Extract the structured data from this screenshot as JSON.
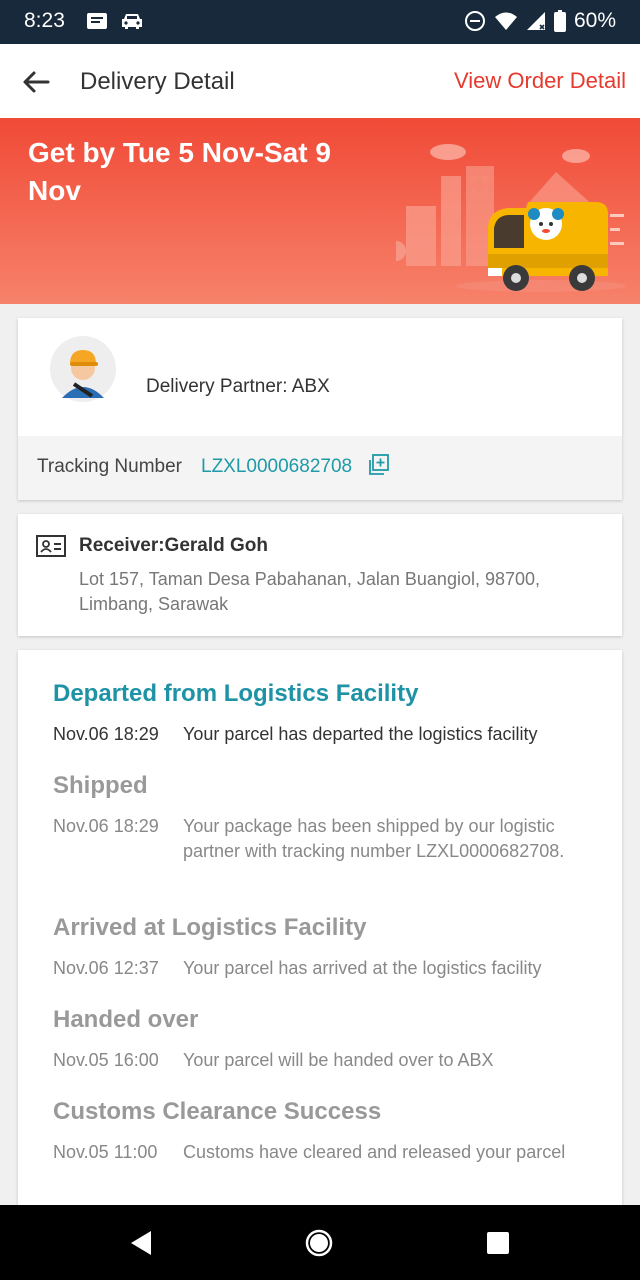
{
  "status_bar": {
    "time": "8:23",
    "battery": "60%",
    "icons_left": [
      "message-icon",
      "car-icon"
    ],
    "icons_right": [
      "do-not-disturb-icon",
      "wifi-icon",
      "signal-icon",
      "battery-icon"
    ]
  },
  "header": {
    "title": "Delivery Detail",
    "order_link": "View Order Detail",
    "accent_color": "#e53a2e"
  },
  "banner": {
    "eta": "Get by Tue 5 Nov-Sat 9 Nov"
  },
  "partner": {
    "label": "Delivery Partner: ABX",
    "tracking_label": "Tracking Number",
    "tracking_number": "LZXL0000682708"
  },
  "receiver": {
    "name": "Receiver:Gerald Goh",
    "address": "Lot 157, Taman Desa Pabahanan, Jalan Buangiol, 98700, Limbang, Sarawak"
  },
  "timeline": {
    "events": [
      {
        "title": "Departed from Logistics Facility",
        "time": "Nov.06 18:29",
        "desc": "Your parcel has departed the logistics facility"
      },
      {
        "title": "Shipped",
        "time": "Nov.06 18:29",
        "desc": "Your package has been shipped by our logistic partner with tracking number LZXL0000682708."
      },
      {
        "title": "Arrived at Logistics Facility",
        "time": "Nov.06 12:37",
        "desc": "Your parcel has arrived at the logistics facility"
      },
      {
        "title": "Handed over",
        "time": "Nov.05 16:00",
        "desc": "Your parcel will be handed over to ABX"
      },
      {
        "title": "Customs Clearance Success",
        "time": "Nov.05 11:00",
        "desc": "Customs have cleared and released your parcel"
      }
    ]
  },
  "colors": {
    "link_teal": "#1e93a6",
    "banner_top": "#f04a37",
    "banner_bottom": "#f7826a"
  }
}
